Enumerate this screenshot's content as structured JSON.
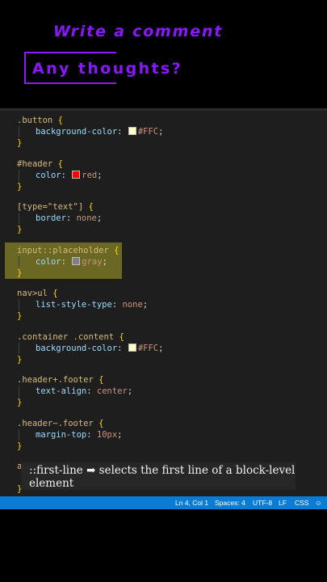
{
  "overlay": {
    "title": "Write a comment",
    "input_placeholder": "Any thoughts?"
  },
  "colors": {
    "accent": "#8a18ff",
    "status_bar": "#0b7cd6",
    "highlight": "#aaa528"
  },
  "code": {
    "blocks": [
      {
        "selector": ".button",
        "property": "background-color",
        "value": "#FFC",
        "swatch": "#ffffcc"
      },
      {
        "selector": "#header",
        "property": "color",
        "value": "red",
        "swatch": "#ff0000"
      },
      {
        "selector": "[type=\"text\"]",
        "property": "border",
        "value": "none"
      },
      {
        "selector": "input::placeholder",
        "property": "color",
        "value": "gray",
        "swatch": "#808080"
      },
      {
        "selector": "nav>ul",
        "property": "list-style-type",
        "value": "none"
      },
      {
        "selector": ".container .content",
        "property": "background-color",
        "value": "#FFC",
        "swatch": "#ffffcc"
      },
      {
        "selector": ".header+.footer",
        "property": "text-align",
        "value": "center"
      },
      {
        "selector": ".header~.footer",
        "property": "margin-top",
        "value": "10px"
      },
      {
        "selector": "a",
        "property": "",
        "value": ""
      }
    ],
    "open_brace": "{",
    "close_brace": "}",
    "colon": ":",
    "semicolon": ";"
  },
  "caption": {
    "text": "::first-line ➡ selects the first line of a block-level element"
  },
  "status_bar": {
    "position": "Ln 4, Col 1",
    "spaces": "Spaces: 4",
    "encoding": "UTF-8",
    "eol": "LF",
    "language": "CSS"
  }
}
